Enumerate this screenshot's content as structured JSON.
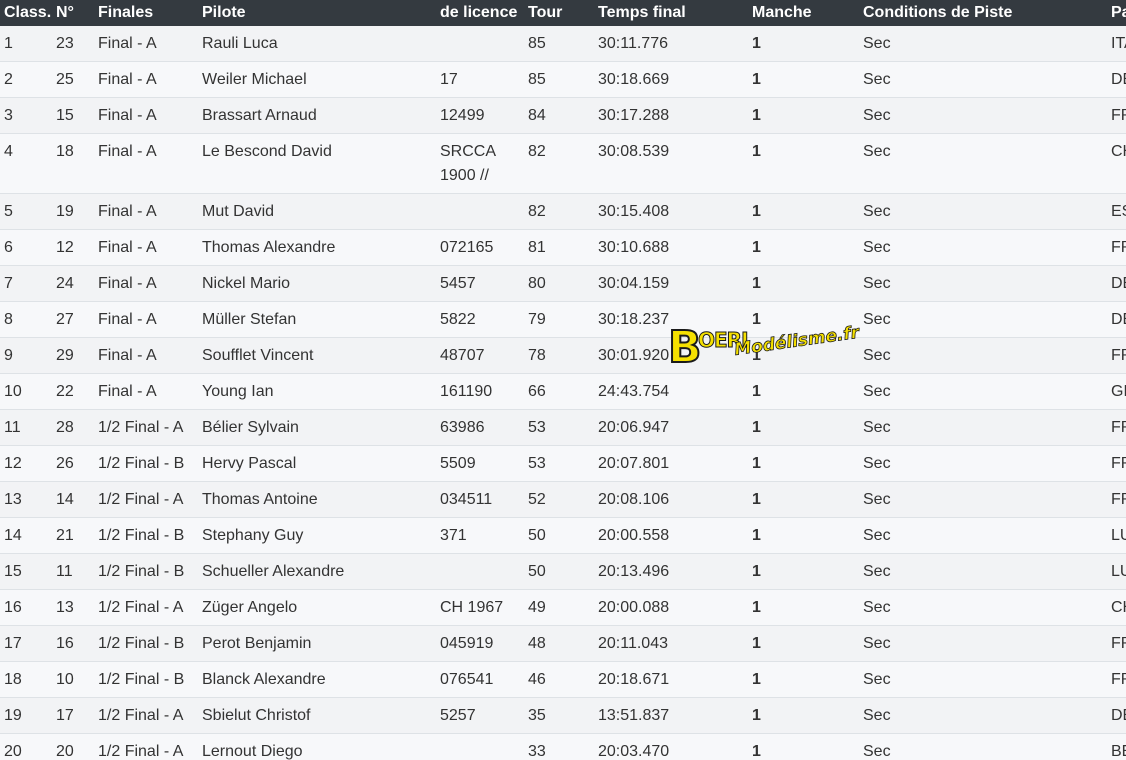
{
  "table": {
    "headers": [
      "Class.",
      "N°",
      "Finales",
      "Pilote",
      "de licence",
      "Tour",
      "Temps final",
      "Manche",
      "Conditions de Piste",
      "Pays"
    ],
    "rows": [
      [
        "1",
        "23",
        "Final - A",
        "Rauli Luca",
        "",
        "85",
        "30:11.776",
        "1",
        "Sec",
        "ITA"
      ],
      [
        "2",
        "25",
        "Final - A",
        "Weiler Michael",
        "17",
        "85",
        "30:18.669",
        "1",
        "Sec",
        "DEU"
      ],
      [
        "3",
        "15",
        "Final - A",
        "Brassart Arnaud",
        "12499",
        "84",
        "30:17.288",
        "1",
        "Sec",
        "FRA"
      ],
      [
        "4",
        "18",
        "Final - A",
        "Le Bescond David",
        "SRCCA 1900 //",
        "82",
        "30:08.539",
        "1",
        "Sec",
        "CHE"
      ],
      [
        "5",
        "19",
        "Final - A",
        "Mut David",
        "",
        "82",
        "30:15.408",
        "1",
        "Sec",
        "ESP"
      ],
      [
        "6",
        "12",
        "Final - A",
        "Thomas Alexandre",
        "072165",
        "81",
        "30:10.688",
        "1",
        "Sec",
        "FRA"
      ],
      [
        "7",
        "24",
        "Final - A",
        "Nickel Mario",
        "5457",
        "80",
        "30:04.159",
        "1",
        "Sec",
        "DEU"
      ],
      [
        "8",
        "27",
        "Final - A",
        "Müller Stefan",
        "5822",
        "79",
        "30:18.237",
        "1",
        "Sec",
        "DEU"
      ],
      [
        "9",
        "29",
        "Final - A",
        "Soufflet Vincent",
        "48707",
        "78",
        "30:01.920",
        "1",
        "Sec",
        "FRA"
      ],
      [
        "10",
        "22",
        "Final - A",
        "Young Ian",
        "161190",
        "66",
        "24:43.754",
        "1",
        "Sec",
        "GBR"
      ],
      [
        "11",
        "28",
        "1/2 Final - A",
        "Bélier Sylvain",
        "63986",
        "53",
        "20:06.947",
        "1",
        "Sec",
        "FRA"
      ],
      [
        "12",
        "26",
        "1/2 Final - B",
        "Hervy Pascal",
        "5509",
        "53",
        "20:07.801",
        "1",
        "Sec",
        "FRA"
      ],
      [
        "13",
        "14",
        "1/2 Final - A",
        "Thomas Antoine",
        "034511",
        "52",
        "20:08.106",
        "1",
        "Sec",
        "FRA"
      ],
      [
        "14",
        "21",
        "1/2 Final - B",
        "Stephany Guy",
        "371",
        "50",
        "20:00.558",
        "1",
        "Sec",
        "LUX"
      ],
      [
        "15",
        "11",
        "1/2 Final - B",
        "Schueller Alexandre",
        "",
        "50",
        "20:13.496",
        "1",
        "Sec",
        "LUX"
      ],
      [
        "16",
        "13",
        "1/2 Final - A",
        "Züger Angelo",
        "CH 1967",
        "49",
        "20:00.088",
        "1",
        "Sec",
        "CHE"
      ],
      [
        "17",
        "16",
        "1/2 Final - B",
        "Perot Benjamin",
        "045919",
        "48",
        "20:11.043",
        "1",
        "Sec",
        "FRA"
      ],
      [
        "18",
        "10",
        "1/2 Final - B",
        "Blanck Alexandre",
        "076541",
        "46",
        "20:18.671",
        "1",
        "Sec",
        "FRA"
      ],
      [
        "19",
        "17",
        "1/2 Final - A",
        "Sbielut Christof",
        "5257",
        "35",
        "13:51.837",
        "1",
        "Sec",
        "DEU"
      ],
      [
        "20",
        "20",
        "1/2 Final - A",
        "Lernout Diego",
        "",
        "33",
        "20:03.470",
        "1",
        "Sec",
        "BEL"
      ]
    ]
  },
  "watermark": {
    "letter": "B",
    "word": "OERI",
    "sub": "Modélisme.fr"
  },
  "colors": {
    "header_bg": "#343a40",
    "header_text": "#ffffff",
    "logo_yellow": "#f5e000"
  }
}
